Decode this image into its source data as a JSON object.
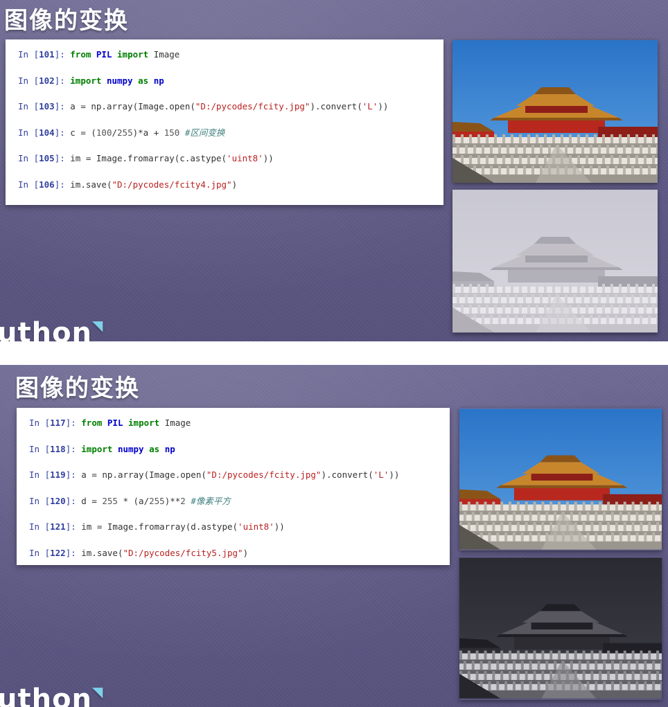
{
  "slides": [
    {
      "title": "图像的变换",
      "cells": [
        {
          "n": "101",
          "parts": [
            [
              "kw",
              "from"
            ],
            [
              "t",
              " "
            ],
            [
              "kw2",
              "PIL"
            ],
            [
              "t",
              " "
            ],
            [
              "kw",
              "import"
            ],
            [
              "t",
              " Image"
            ]
          ]
        },
        {
          "n": "102",
          "parts": [
            [
              "kw",
              "import"
            ],
            [
              "t",
              " "
            ],
            [
              "kw2",
              "numpy"
            ],
            [
              "t",
              " "
            ],
            [
              "kw",
              "as"
            ],
            [
              "t",
              " "
            ],
            [
              "kw2",
              "np"
            ]
          ]
        },
        {
          "n": "103",
          "parts": [
            [
              "t",
              "a = np.array(Image.open("
            ],
            [
              "str",
              "\"D:/pycodes/fcity.jpg\""
            ],
            [
              "t",
              ").convert("
            ],
            [
              "str",
              "'L'"
            ],
            [
              "t",
              "))"
            ]
          ]
        },
        {
          "n": "104",
          "parts": [
            [
              "t",
              "c = ("
            ],
            [
              "num",
              "100"
            ],
            [
              "t",
              "/"
            ],
            [
              "num",
              "255"
            ],
            [
              "t",
              ")*a + "
            ],
            [
              "num",
              "150"
            ],
            [
              "t",
              " "
            ],
            [
              "cmt",
              "#区间变换"
            ]
          ]
        },
        {
          "n": "105",
          "parts": [
            [
              "t",
              "im = Image.fromarray(c.astype("
            ],
            [
              "str",
              "'uint8'"
            ],
            [
              "t",
              "))"
            ]
          ]
        },
        {
          "n": "106",
          "parts": [
            [
              "t",
              "im.save("
            ],
            [
              "str",
              "\"D:/pycodes/fcity4.jpg\""
            ],
            [
              "t",
              ")"
            ]
          ]
        }
      ],
      "images": [
        "forbidden-city-color",
        "forbidden-city-light-gray"
      ],
      "logo": "uthon"
    },
    {
      "title": "图像的变换",
      "cells": [
        {
          "n": "117",
          "parts": [
            [
              "kw",
              "from"
            ],
            [
              "t",
              " "
            ],
            [
              "kw2",
              "PIL"
            ],
            [
              "t",
              " "
            ],
            [
              "kw",
              "import"
            ],
            [
              "t",
              " Image"
            ]
          ]
        },
        {
          "n": "118",
          "parts": [
            [
              "kw",
              "import"
            ],
            [
              "t",
              " "
            ],
            [
              "kw2",
              "numpy"
            ],
            [
              "t",
              " "
            ],
            [
              "kw",
              "as"
            ],
            [
              "t",
              " "
            ],
            [
              "kw2",
              "np"
            ]
          ]
        },
        {
          "n": "119",
          "parts": [
            [
              "t",
              "a = np.array(Image.open("
            ],
            [
              "str",
              "\"D:/pycodes/fcity.jpg\""
            ],
            [
              "t",
              ").convert("
            ],
            [
              "str",
              "'L'"
            ],
            [
              "t",
              "))"
            ]
          ]
        },
        {
          "n": "120",
          "parts": [
            [
              "t",
              "d = "
            ],
            [
              "num",
              "255"
            ],
            [
              "t",
              " * (a/"
            ],
            [
              "num",
              "255"
            ],
            [
              "t",
              ")**"
            ],
            [
              "num",
              "2"
            ],
            [
              "t",
              " "
            ],
            [
              "cmt",
              "#像素平方"
            ]
          ]
        },
        {
          "n": "121",
          "parts": [
            [
              "t",
              "im = Image.fromarray(d.astype("
            ],
            [
              "str",
              "'uint8'"
            ],
            [
              "t",
              "))"
            ]
          ]
        },
        {
          "n": "122",
          "parts": [
            [
              "t",
              "im.save("
            ],
            [
              "str",
              "\"D:/pycodes/fcity5.jpg\""
            ],
            [
              "t",
              ")"
            ]
          ]
        }
      ],
      "images": [
        "forbidden-city-color",
        "forbidden-city-dark-gray"
      ],
      "logo": "uthon"
    }
  ],
  "prompt_in": "In",
  "colors": {
    "slide_bg": "#5f5a86",
    "keyword": "#008000",
    "module": "#0000cc",
    "string": "#ba2121",
    "comment": "#408080",
    "prompt": "#303f9f"
  }
}
